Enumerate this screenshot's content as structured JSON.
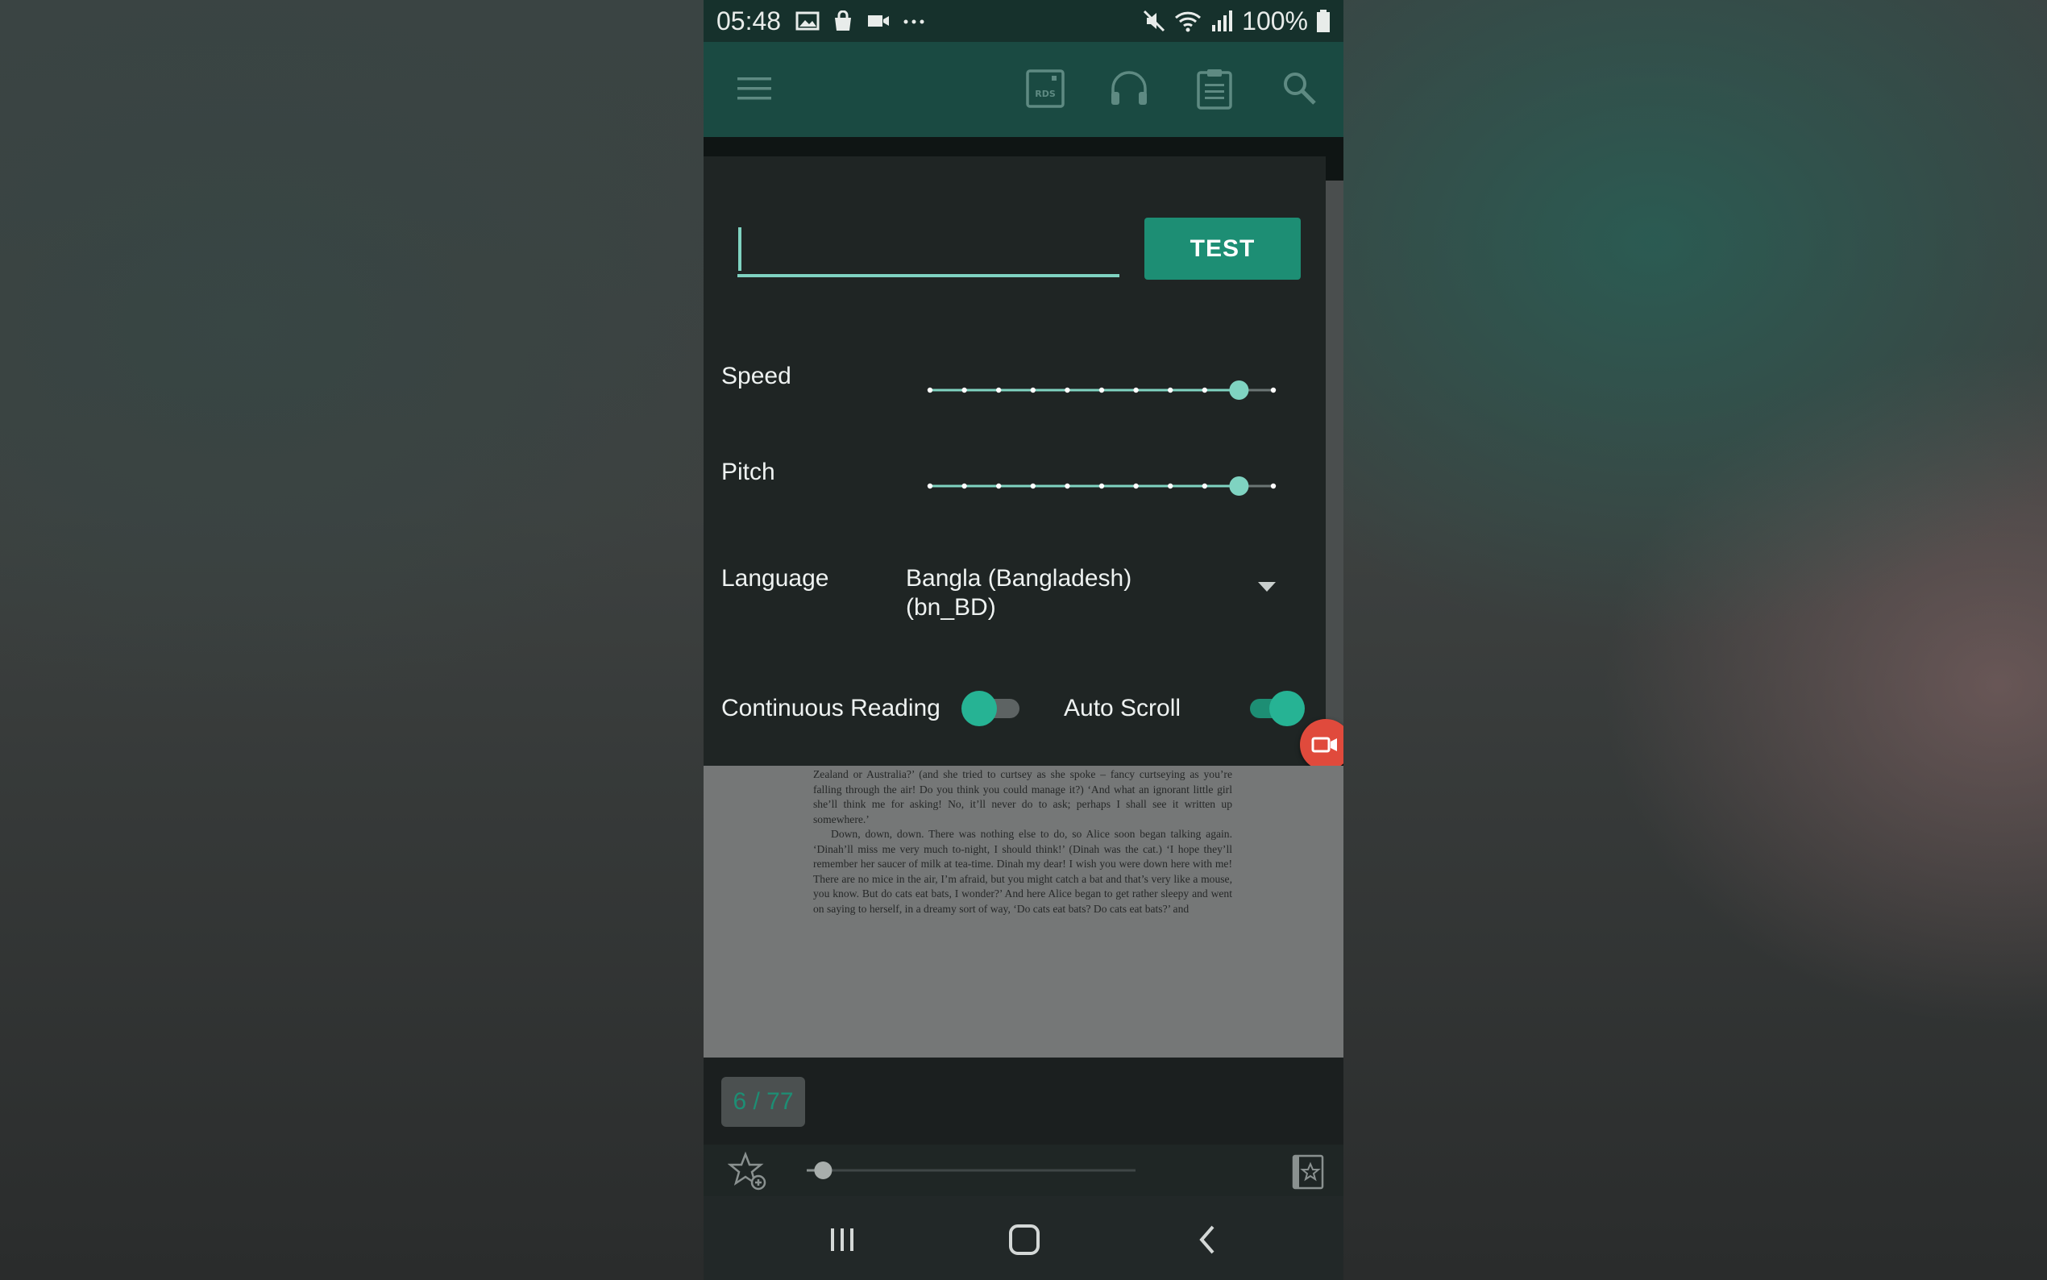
{
  "status_bar": {
    "time": "05:48",
    "battery": "100%"
  },
  "tts_panel": {
    "test_input_value": "",
    "test_button_label": "TEST",
    "speed_label": "Speed",
    "speed_value": 0.9,
    "pitch_label": "Pitch",
    "pitch_value": 0.9,
    "language_label": "Language",
    "language_value": "Bangla (Bangladesh) (bn_BD)",
    "continuous_reading_label": "Continuous Reading",
    "continuous_reading_on": false,
    "auto_scroll_label": "Auto Scroll",
    "auto_scroll_on": true
  },
  "document": {
    "paragraph1": "Zealand or Australia?’ (and she tried to curtsey as she spoke – fancy curtseying as you’re falling through the air! Do you think you could manage it?) ‘And what an ignorant little girl she’ll think me for asking! No, it’ll never do to ask; perhaps I shall see it written up somewhere.’",
    "paragraph2": "Down, down, down. There was nothing else to do, so Alice soon began talking again. ‘Dinah’ll miss me very much to-night, I should think!’ (Dinah was the cat.) ‘I hope they’ll remember her saucer of milk at tea-time. Dinah my dear! I wish you were down here with me! There are no mice in the air, I’m afraid, but you might catch a bat and that’s very like a mouse, you know. But do cats eat bats, I wonder?’ And here Alice began to get rather sleepy and went on saying to herself, in a dreamy sort of way, ‘Do cats eat bats? Do cats eat bats?’ and"
  },
  "page_indicator": "6 / 77",
  "page_progress": 0.05,
  "icons": {
    "menu": "hamburger-menu-icon",
    "rds": "rds-icon",
    "headphones": "headphones-icon",
    "clipboard": "clipboard-icon",
    "search": "search-icon",
    "add_bookmark": "star-add-icon",
    "bookmarks": "bookmark-list-icon",
    "recent_apps": "recent-apps-icon",
    "home": "home-icon",
    "back": "back-icon"
  },
  "colors": {
    "accent": "#1d8e74",
    "accent_light": "#7fd3c1",
    "app_bar": "#1a4a42",
    "fab": "#e04a3c"
  }
}
